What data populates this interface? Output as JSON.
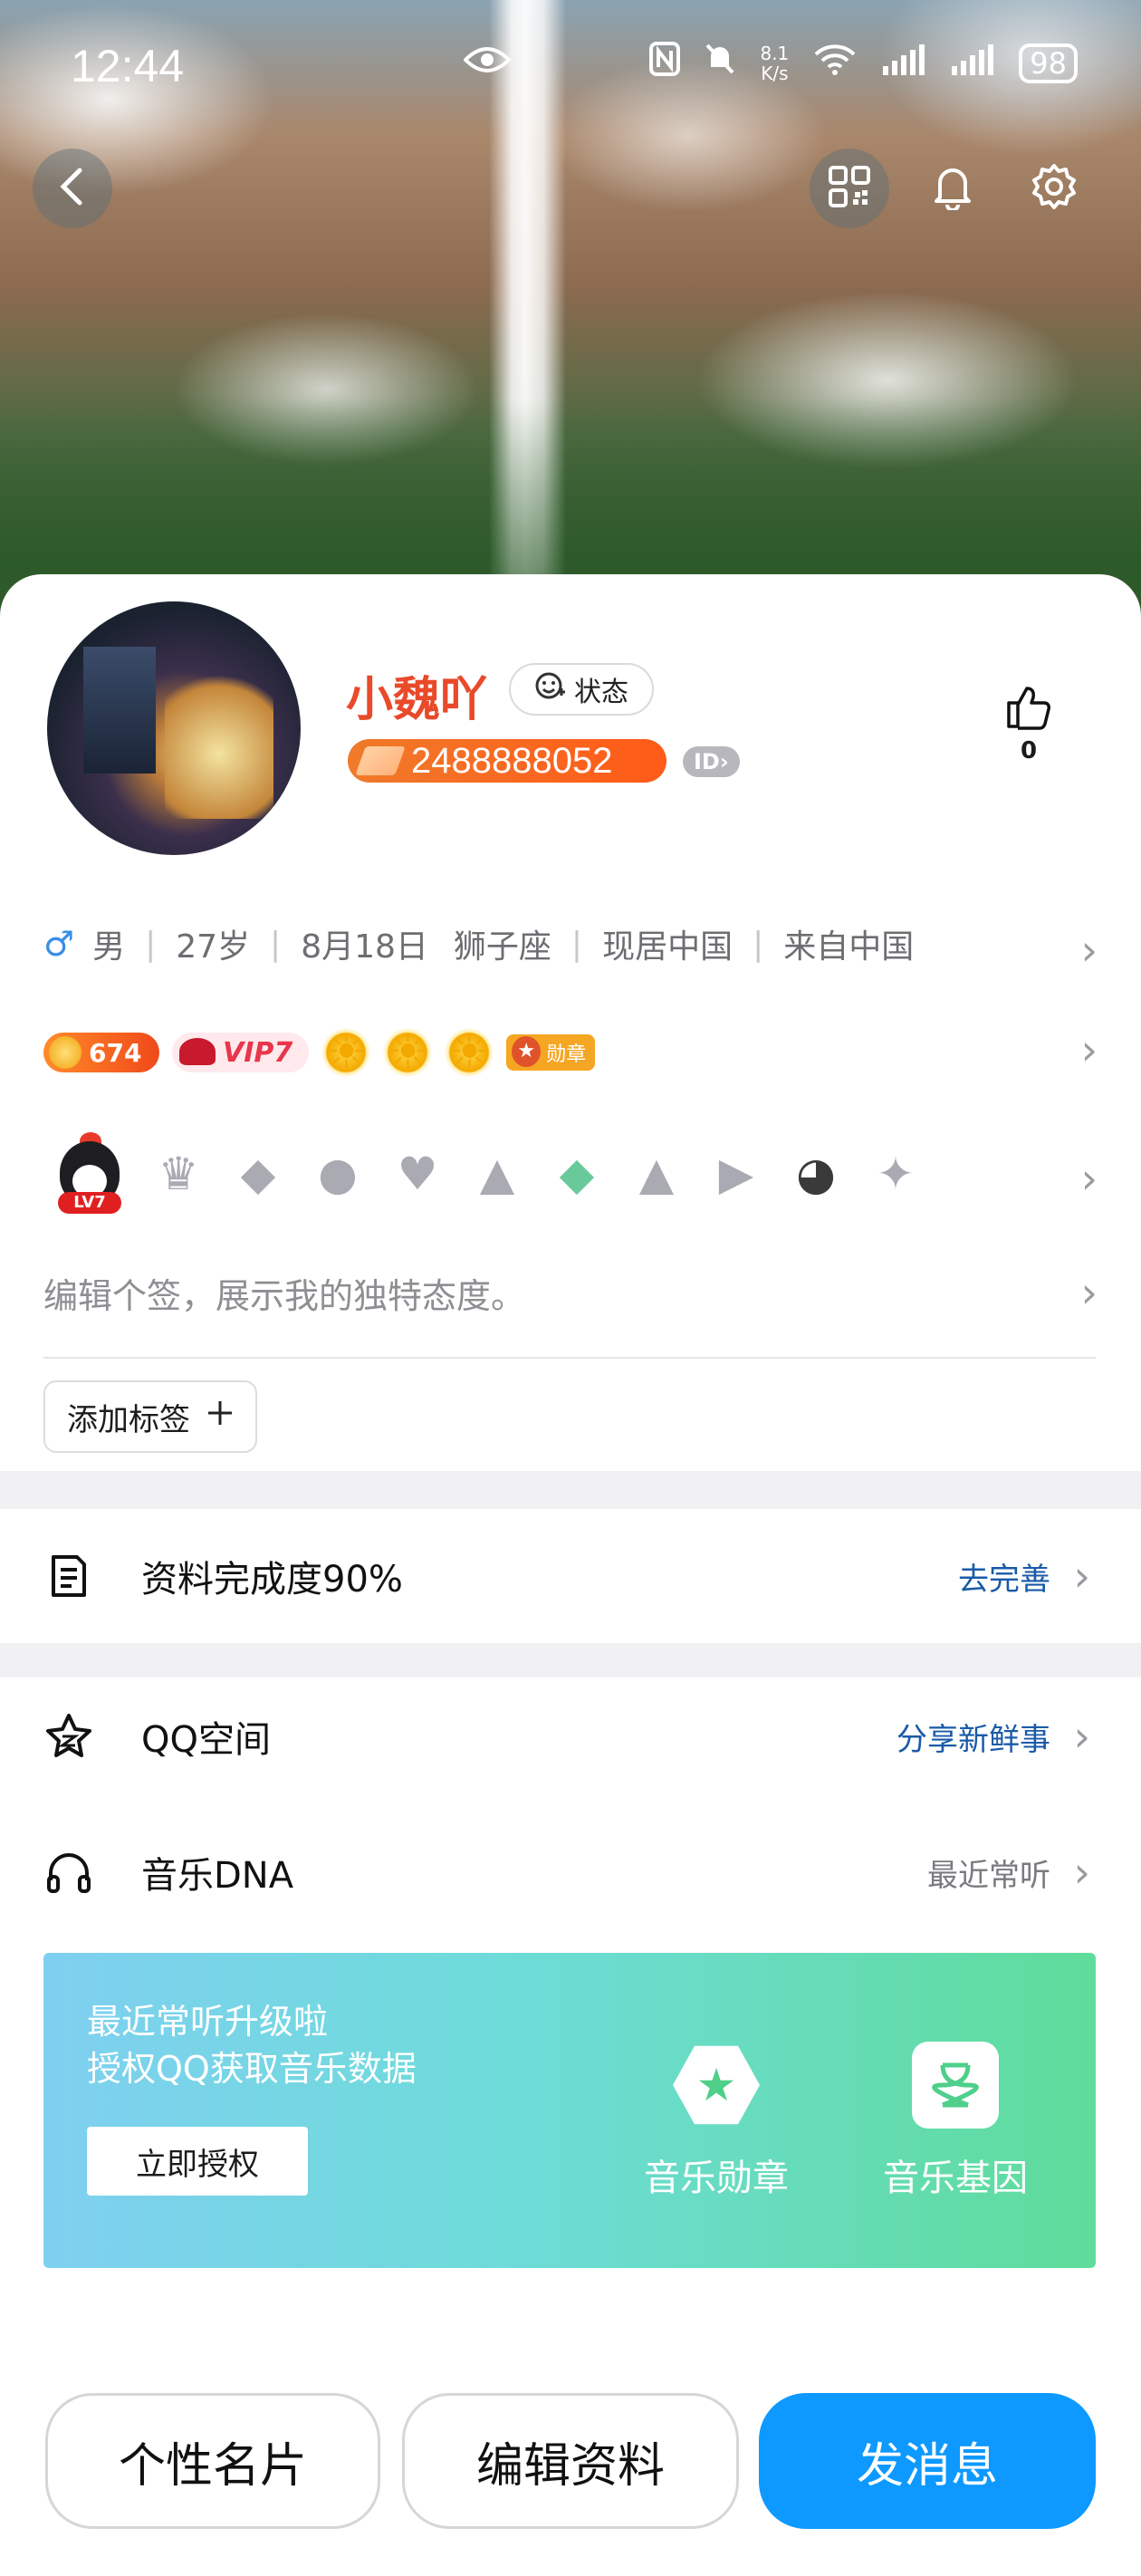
{
  "status_bar": {
    "time": "12:44",
    "net_speed_value": "8.1",
    "net_speed_unit": "K/s",
    "battery": "98"
  },
  "profile": {
    "name": "小魏吖",
    "status_chip": "状态",
    "uid": "2488888052",
    "id_chip": "ID",
    "likes": "0",
    "info": {
      "gender": "男",
      "age": "27岁",
      "birthday": "8月18日",
      "zodiac": "狮子座",
      "residence": "现居中国",
      "hometown": "来自中国"
    },
    "coins": "674",
    "vip": "VIP7",
    "medal": "勋章",
    "level": "LV7",
    "signature_placeholder": "编辑个签，展示我的独特态度。",
    "add_tag": "添加标签"
  },
  "completeness": {
    "title": "资料完成度90%",
    "action": "去完善"
  },
  "qzone": {
    "title": "QQ空间",
    "action": "分享新鲜事"
  },
  "music": {
    "title": "音乐DNA",
    "action": "最近常听",
    "card_line1": "最近常听升级啦",
    "card_line2": "授权QQ获取音乐数据",
    "authorize": "立即授权",
    "badge": "音乐勋章",
    "gene": "音乐基因"
  },
  "buttons": {
    "card": "个性名片",
    "edit": "编辑资料",
    "message": "发消息"
  },
  "colors": {
    "name": "#e84a2a",
    "uid_badge": "#f05a20",
    "primary": "#0d99ff",
    "link_blue": "#1a5aa8",
    "music_gradient_start": "#7fd0f0",
    "music_gradient_end": "#5fdc9a"
  },
  "icons": [
    "back-icon",
    "qr-code-icon",
    "bell-icon",
    "gear-icon",
    "smile-icon",
    "thumbs-up-icon",
    "document-icon",
    "star-icon",
    "headphones-icon",
    "star-hexagon-icon",
    "dna-icon"
  ]
}
